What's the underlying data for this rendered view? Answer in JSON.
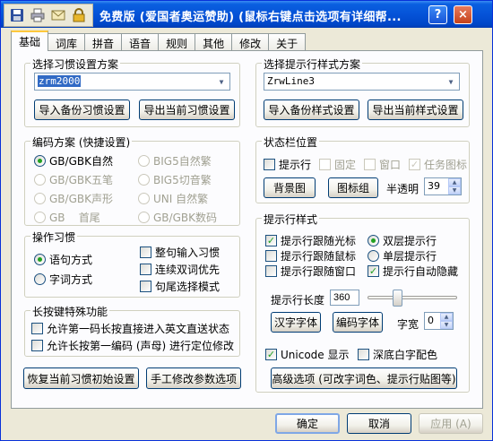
{
  "window": {
    "title": "免费版 (爱国者奥运赞助) (鼠标右键点击选项有详细帮...",
    "qa_icons": [
      "save-icon",
      "print-icon",
      "mail-icon",
      "lock-icon"
    ],
    "help_btn": "?",
    "close_btn": "×"
  },
  "tabs": [
    {
      "label": "基础",
      "active": true
    },
    {
      "label": "词库"
    },
    {
      "label": "拼音"
    },
    {
      "label": "语音"
    },
    {
      "label": "规则"
    },
    {
      "label": "其他"
    },
    {
      "label": "修改"
    },
    {
      "label": "关于"
    }
  ],
  "habit_scheme": {
    "title": "选择习惯设置方案",
    "value": "zrm2000",
    "import_btn": "导入备份习惯设置",
    "export_btn": "导出当前习惯设置"
  },
  "hint_scheme": {
    "title": "选择提示行样式方案",
    "value": "ZrwLine3",
    "import_btn": "导入备份样式设置",
    "export_btn": "导出当前样式设置"
  },
  "encoding": {
    "title": "编码方案 (快捷设置)",
    "options_left": [
      "GB/GBK自然",
      "GB/GBK五笔",
      "GB/GBK声形",
      "GB    首尾"
    ],
    "options_right": [
      "BIG5自然繁",
      "BIG5切音繁",
      "UNI 自然繁",
      "GB/GBK数码"
    ]
  },
  "status_bar": {
    "title": "状态栏位置",
    "checks": [
      "提示行",
      "固定",
      "窗口",
      "任务图标"
    ],
    "bg_btn": "背景图",
    "icon_btn": "图标组",
    "transparency_label": "半透明",
    "transparency_value": "39"
  },
  "operation": {
    "title": "操作习惯",
    "radios": [
      "语句方式",
      "字词方式"
    ],
    "checks": [
      "整句输入习惯",
      "连续双词优先",
      "句尾选择模式"
    ]
  },
  "hint_style": {
    "title": "提示行样式",
    "checks_left": [
      "提示行跟随光标",
      "提示行跟随鼠标",
      "提示行跟随窗口"
    ],
    "radio1": "双层提示行",
    "radio2": "单层提示行",
    "auto_hide": "提示行自动隐藏",
    "length_label": "提示行长度",
    "length_value": "360",
    "length_slider_pct": 0.33,
    "hanzi_font_btn": "汉字字体",
    "code_font_btn": "编码字体",
    "width_label": "字宽",
    "width_value": "0",
    "unicode_label": "Unicode 显示",
    "deep_color_label": "深底白字配色",
    "advanced_btn": "高级选项 (可改字词色、提示行贴图等)"
  },
  "long_press": {
    "title": "长按键特殊功能",
    "checks": [
      "允许第一码长按直接进入英文直送状态",
      "允许长按第一编码 (声母) 进行定位修改"
    ]
  },
  "bottom_left": {
    "restore_btn": "恢复当前习惯初始设置",
    "manual_btn": "手工修改参数选项"
  },
  "footer": {
    "ok": "确定",
    "cancel": "取消",
    "apply": "应用 (A)"
  }
}
